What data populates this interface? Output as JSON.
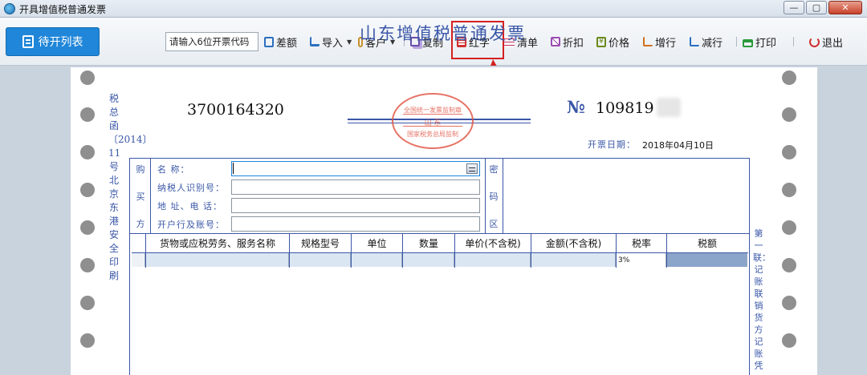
{
  "window": {
    "title": "开具增值税普通发票",
    "min": "—",
    "max": "▢",
    "close": "✕"
  },
  "toolbar": {
    "pending_label": "待开列表",
    "code_input_value": "请输入6位开票代码",
    "items": [
      {
        "label": "差额",
        "icon": "diff-icon",
        "color": "#2a6fc0"
      },
      {
        "label": "导入",
        "icon": "import-icon",
        "color": "#2a6fc0"
      },
      {
        "label": "客户",
        "icon": "customer-icon",
        "color": "#c8902a"
      },
      {
        "label": "复制",
        "icon": "copy-icon",
        "color": "#6a4ca8"
      },
      {
        "label": "红字",
        "icon": "red-invoice-icon",
        "color": "#d03030"
      },
      {
        "label": "清单",
        "icon": "list-icon",
        "color": "#c03060"
      },
      {
        "label": "折扣",
        "icon": "discount-icon",
        "color": "#9a4cb0"
      },
      {
        "label": "价格",
        "icon": "price-icon",
        "color": "#6a8a1a"
      },
      {
        "label": "增行",
        "icon": "add-row-icon",
        "color": "#d07020"
      },
      {
        "label": "减行",
        "icon": "remove-row-icon",
        "color": "#2a6fc0"
      },
      {
        "label": "打印",
        "icon": "print-icon",
        "color": "#2a9a3a"
      },
      {
        "label": "退出",
        "icon": "power-icon",
        "color": "#d03030"
      }
    ]
  },
  "invoice": {
    "title": "山东增值税普通发票",
    "code": "3700164320",
    "number_symbol": "№",
    "number": "109819",
    "date_label": "开票日期：",
    "date": "2018年04月10日",
    "seal": {
      "top": "全国统一发票监制章",
      "middle": "山  东",
      "bottom": "国家税务总局监制"
    }
  },
  "buyer": {
    "side_label": [
      "购",
      "买",
      "方"
    ],
    "fields": [
      {
        "label": "名      称："
      },
      {
        "label": "纳税人识别号："
      },
      {
        "label": "地 址、电 话："
      },
      {
        "label": "开户行及账号："
      }
    ],
    "password_label": [
      "密",
      "码",
      "区"
    ]
  },
  "table": {
    "headers": [
      "货物或应税劳务、服务名称",
      "规格型号",
      "单位",
      "数量",
      "单价(不含税)",
      "金额(不含税)",
      "税率",
      "税额"
    ],
    "rows": [
      {
        "rate": "3%"
      }
    ]
  },
  "margins": {
    "left_text": "税总函〔2014〕 11 号北京东港安全印刷",
    "right_text": "第一联：记账联 销货方记账凭"
  }
}
